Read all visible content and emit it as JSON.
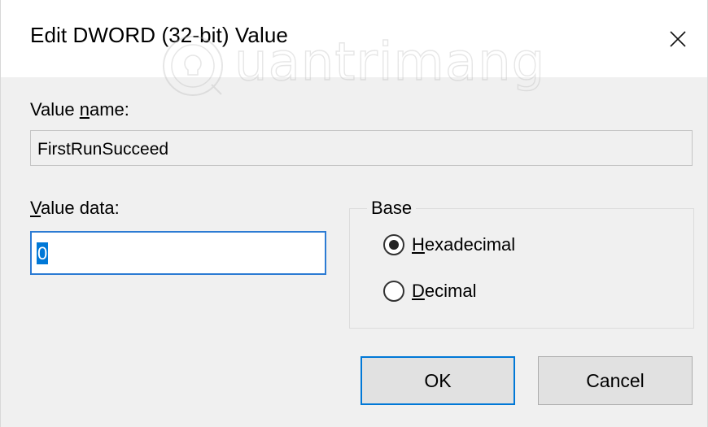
{
  "window": {
    "title": "Edit DWORD (32-bit) Value",
    "close_glyph": "✕"
  },
  "watermark": {
    "text": "uantrimang",
    "logo": "quantrimang-logo"
  },
  "value_name": {
    "label_pre": "Value ",
    "label_accel": "n",
    "label_post": "ame:",
    "value": "FirstRunSucceed"
  },
  "value_data": {
    "label_accel": "V",
    "label_post": "alue data:",
    "value": "0"
  },
  "base": {
    "legend": "Base",
    "options": [
      {
        "accel": "H",
        "rest": "exadecimal",
        "selected": true
      },
      {
        "accel": "D",
        "rest": "ecimal",
        "selected": false
      }
    ]
  },
  "buttons": {
    "ok": "OK",
    "cancel": "Cancel"
  },
  "colors": {
    "accent": "#0078d7",
    "dialog_bg": "#f0f0f0"
  }
}
